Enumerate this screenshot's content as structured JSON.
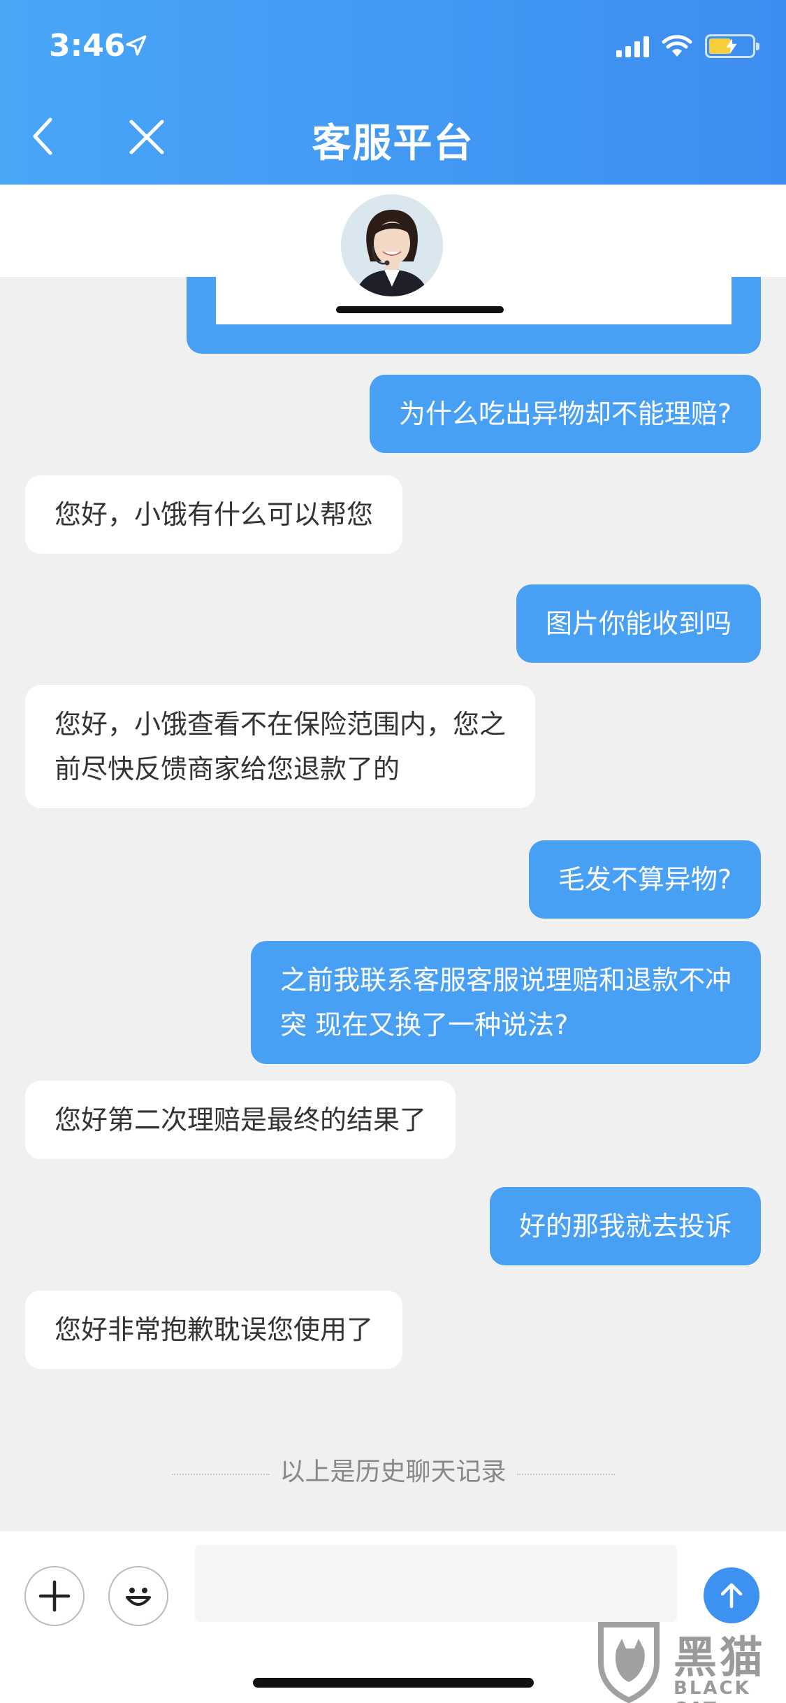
{
  "status_bar": {
    "time": "3:46",
    "icons": [
      "location-arrow-icon",
      "cellular-signal-icon",
      "wifi-icon",
      "battery-charging-icon"
    ]
  },
  "header": {
    "title": "客服平台",
    "back_icon": "chevron-left-icon",
    "close_icon": "close-icon",
    "background_colors": [
      "#48a6f7",
      "#3d8df0"
    ]
  },
  "agent": {
    "avatar_icon": "agent-avatar"
  },
  "messages": [
    {
      "role": "me",
      "text": "为什么吃出异物却不能理赔?"
    },
    {
      "role": "bot",
      "text": "您好，小饿有什么可以帮您"
    },
    {
      "role": "me",
      "text": "图片你能收到吗"
    },
    {
      "role": "bot",
      "lines": [
        "您好，小饿查看不在保险范围内，您之",
        "前尽快反馈商家给您退款了的"
      ]
    },
    {
      "role": "me",
      "text": "毛发不算异物?"
    },
    {
      "role": "me",
      "lines": [
        "之前我联系客服客服说理赔和退款不冲",
        "突 现在又换了一种说法?"
      ]
    },
    {
      "role": "bot",
      "text": "您好第二次理赔是最终的结果了"
    },
    {
      "role": "me",
      "text": "好的那我就去投诉"
    },
    {
      "role": "bot",
      "text": "您好非常抱歉耽误您使用了"
    }
  ],
  "history_divider": "以上是历史聊天记录",
  "input_bar": {
    "plus_icon": "plus-icon",
    "emoji_icon": "emoji-icon",
    "input_value": "",
    "send_icon": "arrow-up-icon"
  },
  "watermark": {
    "title": "黑猫",
    "subtitle": "BLACK CAT"
  },
  "colors": {
    "accent": "#48a0f5",
    "chat_bg": "#f0f0f0",
    "bot_bubble": "#ffffff",
    "send_button": "#3d92f1"
  }
}
